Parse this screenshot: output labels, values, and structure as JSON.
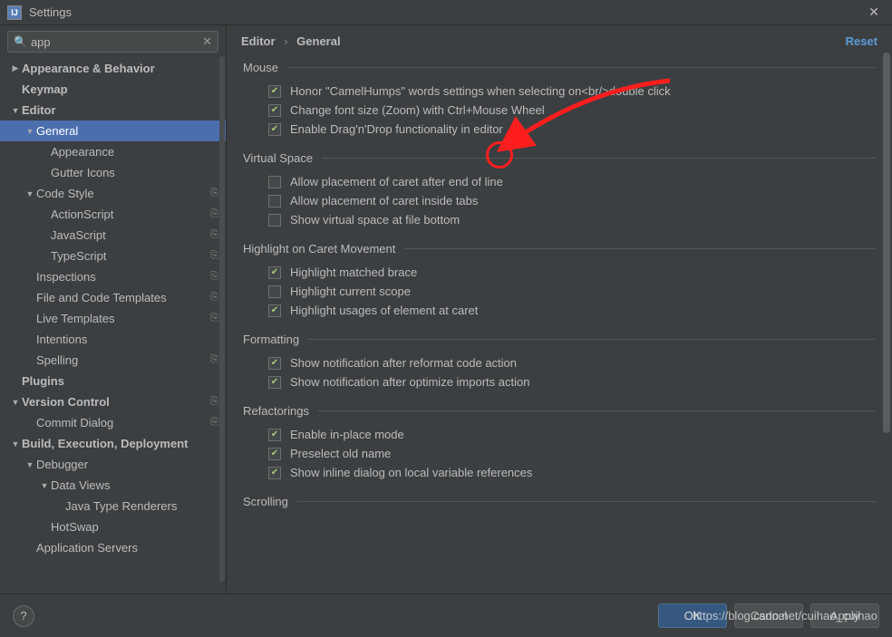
{
  "window": {
    "title": "Settings"
  },
  "search": {
    "value": "app"
  },
  "sidebar": {
    "items": [
      {
        "label": "Appearance & Behavior",
        "level": 0,
        "arrow": "right",
        "bold": true,
        "badge": false
      },
      {
        "label": "Keymap",
        "level": 0,
        "arrow": "none",
        "bold": true,
        "badge": false
      },
      {
        "label": "Editor",
        "level": 0,
        "arrow": "down",
        "bold": true,
        "badge": false
      },
      {
        "label": "General",
        "level": 1,
        "arrow": "down",
        "bold": false,
        "selected": true,
        "badge": false
      },
      {
        "label": "Appearance",
        "level": 2,
        "arrow": "none",
        "bold": false,
        "badge": false
      },
      {
        "label": "Gutter Icons",
        "level": 2,
        "arrow": "none",
        "bold": false,
        "badge": false
      },
      {
        "label": "Code Style",
        "level": 1,
        "arrow": "down",
        "bold": false,
        "badge": true
      },
      {
        "label": "ActionScript",
        "level": 2,
        "arrow": "none",
        "bold": false,
        "badge": true
      },
      {
        "label": "JavaScript",
        "level": 2,
        "arrow": "none",
        "bold": false,
        "badge": true
      },
      {
        "label": "TypeScript",
        "level": 2,
        "arrow": "none",
        "bold": false,
        "badge": true
      },
      {
        "label": "Inspections",
        "level": 1,
        "arrow": "none",
        "bold": false,
        "badge": true
      },
      {
        "label": "File and Code Templates",
        "level": 1,
        "arrow": "none",
        "bold": false,
        "badge": true
      },
      {
        "label": "Live Templates",
        "level": 1,
        "arrow": "none",
        "bold": false,
        "badge": true
      },
      {
        "label": "Intentions",
        "level": 1,
        "arrow": "none",
        "bold": false,
        "badge": false
      },
      {
        "label": "Spelling",
        "level": 1,
        "arrow": "none",
        "bold": false,
        "badge": true
      },
      {
        "label": "Plugins",
        "level": 0,
        "arrow": "none",
        "bold": true,
        "badge": false
      },
      {
        "label": "Version Control",
        "level": 0,
        "arrow": "down",
        "bold": true,
        "badge": true
      },
      {
        "label": "Commit Dialog",
        "level": 1,
        "arrow": "none",
        "bold": false,
        "badge": true
      },
      {
        "label": "Build, Execution, Deployment",
        "level": 0,
        "arrow": "down",
        "bold": true,
        "badge": false
      },
      {
        "label": "Debugger",
        "level": 1,
        "arrow": "down",
        "bold": false,
        "badge": false
      },
      {
        "label": "Data Views",
        "level": 2,
        "arrow": "down",
        "bold": false,
        "badge": false
      },
      {
        "label": "Java Type Renderers",
        "level": 3,
        "arrow": "none",
        "bold": false,
        "badge": false
      },
      {
        "label": "HotSwap",
        "level": 2,
        "arrow": "none",
        "bold": false,
        "badge": false
      },
      {
        "label": "Application Servers",
        "level": 1,
        "arrow": "none",
        "bold": false,
        "badge": false
      }
    ]
  },
  "breadcrumb": {
    "part1": "Editor",
    "sep": "›",
    "part2": "General"
  },
  "reset_label": "Reset",
  "sections": {
    "mouse": {
      "title": "Mouse",
      "opts": [
        {
          "checked": true,
          "label": "Honor \"CamelHumps\" words settings when selecting on<br/>double click"
        },
        {
          "checked": true,
          "label": "Change font size (Zoom) with Ctrl+Mouse Wheel"
        },
        {
          "checked": true,
          "label": "Enable Drag'n'Drop functionality in editor"
        }
      ]
    },
    "virtual_space": {
      "title": "Virtual Space",
      "opts": [
        {
          "checked": false,
          "label": "Allow placement of caret after end of line"
        },
        {
          "checked": false,
          "label": "Allow placement of caret inside tabs"
        },
        {
          "checked": false,
          "label": "Show virtual space at file bottom"
        }
      ]
    },
    "highlight": {
      "title": "Highlight on Caret Movement",
      "opts": [
        {
          "checked": true,
          "label": "Highlight matched brace"
        },
        {
          "checked": false,
          "label": "Highlight current scope"
        },
        {
          "checked": true,
          "label": "Highlight usages of element at caret"
        }
      ]
    },
    "formatting": {
      "title": "Formatting",
      "opts": [
        {
          "checked": true,
          "label": "Show notification after reformat code action"
        },
        {
          "checked": true,
          "label": "Show notification after optimize imports action"
        }
      ]
    },
    "refactorings": {
      "title": "Refactorings",
      "opts": [
        {
          "checked": true,
          "label": "Enable in-place mode"
        },
        {
          "checked": true,
          "label": "Preselect old name"
        },
        {
          "checked": true,
          "label": "Show inline dialog on local variable references"
        }
      ]
    },
    "scrolling": {
      "title": "Scrolling",
      "opts": []
    }
  },
  "footer": {
    "help": "?",
    "ok": "OK",
    "cancel": "Cancel",
    "apply": "Apply"
  },
  "watermark": "https://blog.csdn.net/cuihao_cuihao",
  "badge_icon": "⎘"
}
